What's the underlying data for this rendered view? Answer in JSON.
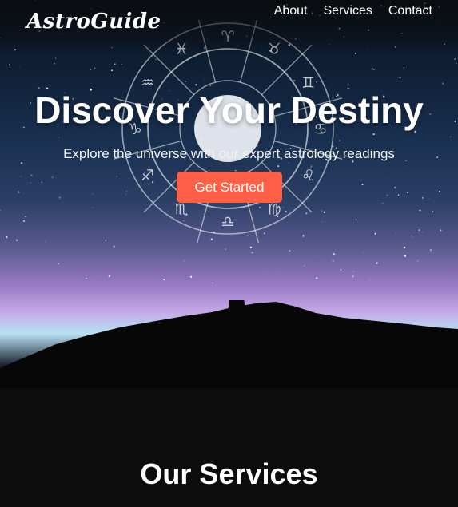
{
  "brand": {
    "logo_text": "AstroGuide"
  },
  "nav": {
    "items": [
      {
        "label": "About"
      },
      {
        "label": "Services"
      },
      {
        "label": "Contact"
      }
    ]
  },
  "hero": {
    "title": "Discover Your Destiny",
    "subtitle": "Explore the universe with our expert astrology readings",
    "cta_label": "Get Started",
    "zodiac_signs": [
      "♈",
      "♉",
      "♊",
      "♋",
      "♌",
      "♍",
      "♎",
      "♏",
      "♐",
      "♑",
      "♒",
      "♓"
    ]
  },
  "services": {
    "title": "Our Services"
  },
  "colors": {
    "accent": "#ff5f45",
    "page_background": "#0c0c0c",
    "text": "#ffffff"
  }
}
